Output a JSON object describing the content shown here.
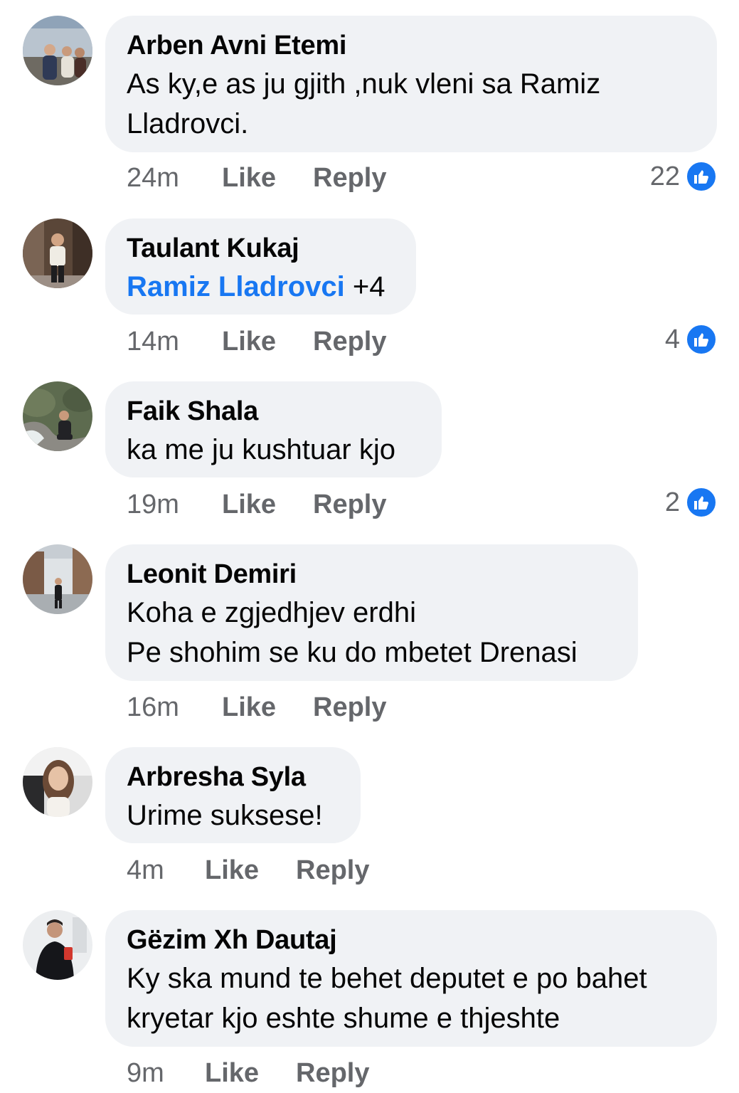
{
  "comments": [
    {
      "author": "Arben Avni Etemi",
      "text": "As ky,e as ju gjith ,nuk vleni sa Ramiz\nLladrovci.",
      "time": "24m",
      "like_label": "Like",
      "reply_label": "Reply",
      "reaction_count": "22",
      "reaction_icon": "like-icon"
    },
    {
      "author": "Taulant Kukaj",
      "mention": "Ramiz Lladrovci",
      "text": " +4",
      "time": "14m",
      "like_label": "Like",
      "reply_label": "Reply",
      "reaction_count": "4",
      "reaction_icon": "like-icon"
    },
    {
      "author": "Faik Shala",
      "text": "ka me ju kushtuar kjo",
      "time": "19m",
      "like_label": "Like",
      "reply_label": "Reply",
      "reaction_count": "2",
      "reaction_icon": "like-icon"
    },
    {
      "author": "Leonit Demiri",
      "text": "Koha e zgjedhjev erdhi\nPe shohim se ku do mbetet Drenasi",
      "time": "16m",
      "like_label": "Like",
      "reply_label": "Reply"
    },
    {
      "author": "Arbresha Syla",
      "text": "Urime suksese!",
      "time": "4m",
      "like_label": "Like",
      "reply_label": "Reply"
    },
    {
      "author": "Gëzim Xh Dautaj",
      "text": "Ky ska mund te behet deputet e po bahet\nkryetar kjo eshte shume e thjeshte",
      "time": "9m",
      "like_label": "Like",
      "reply_label": "Reply"
    }
  ],
  "colors": {
    "bubble": "#f0f2f5",
    "meta_text": "#65676b",
    "accent": "#1877f2"
  }
}
